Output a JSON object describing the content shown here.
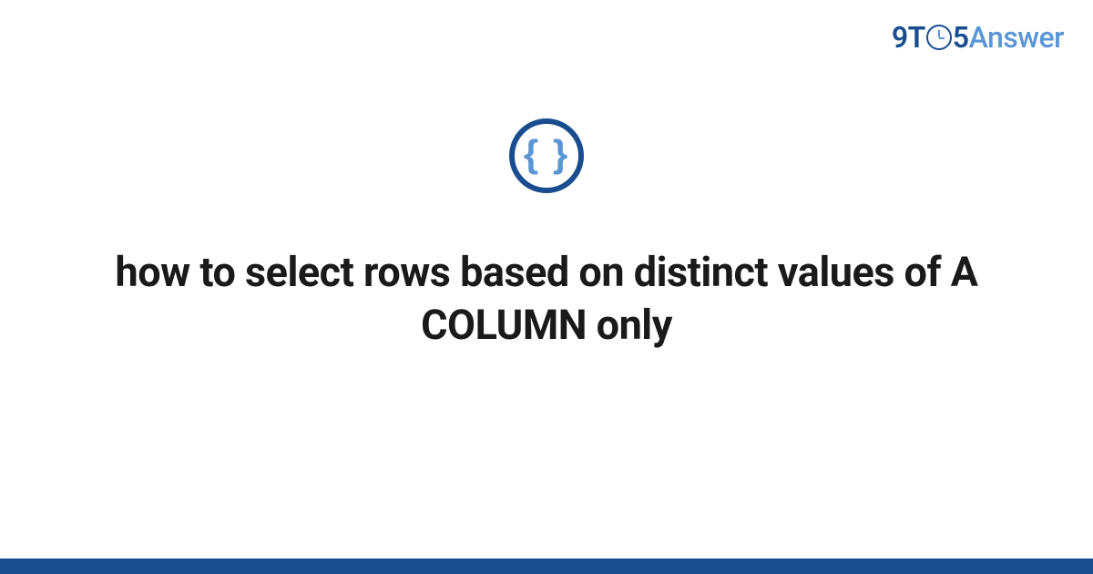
{
  "header": {
    "logo_prefix": "9T",
    "logo_suffix": "5",
    "logo_word": "Answer"
  },
  "center": {
    "icon_label": "braces-icon",
    "braces_text": "{ }",
    "title": "how to select rows based on distinct values of A COLUMN only"
  },
  "colors": {
    "brand_dark": "#1a4d8f",
    "brand_light": "#5a95d6",
    "text_dark": "#1a1a1a"
  }
}
